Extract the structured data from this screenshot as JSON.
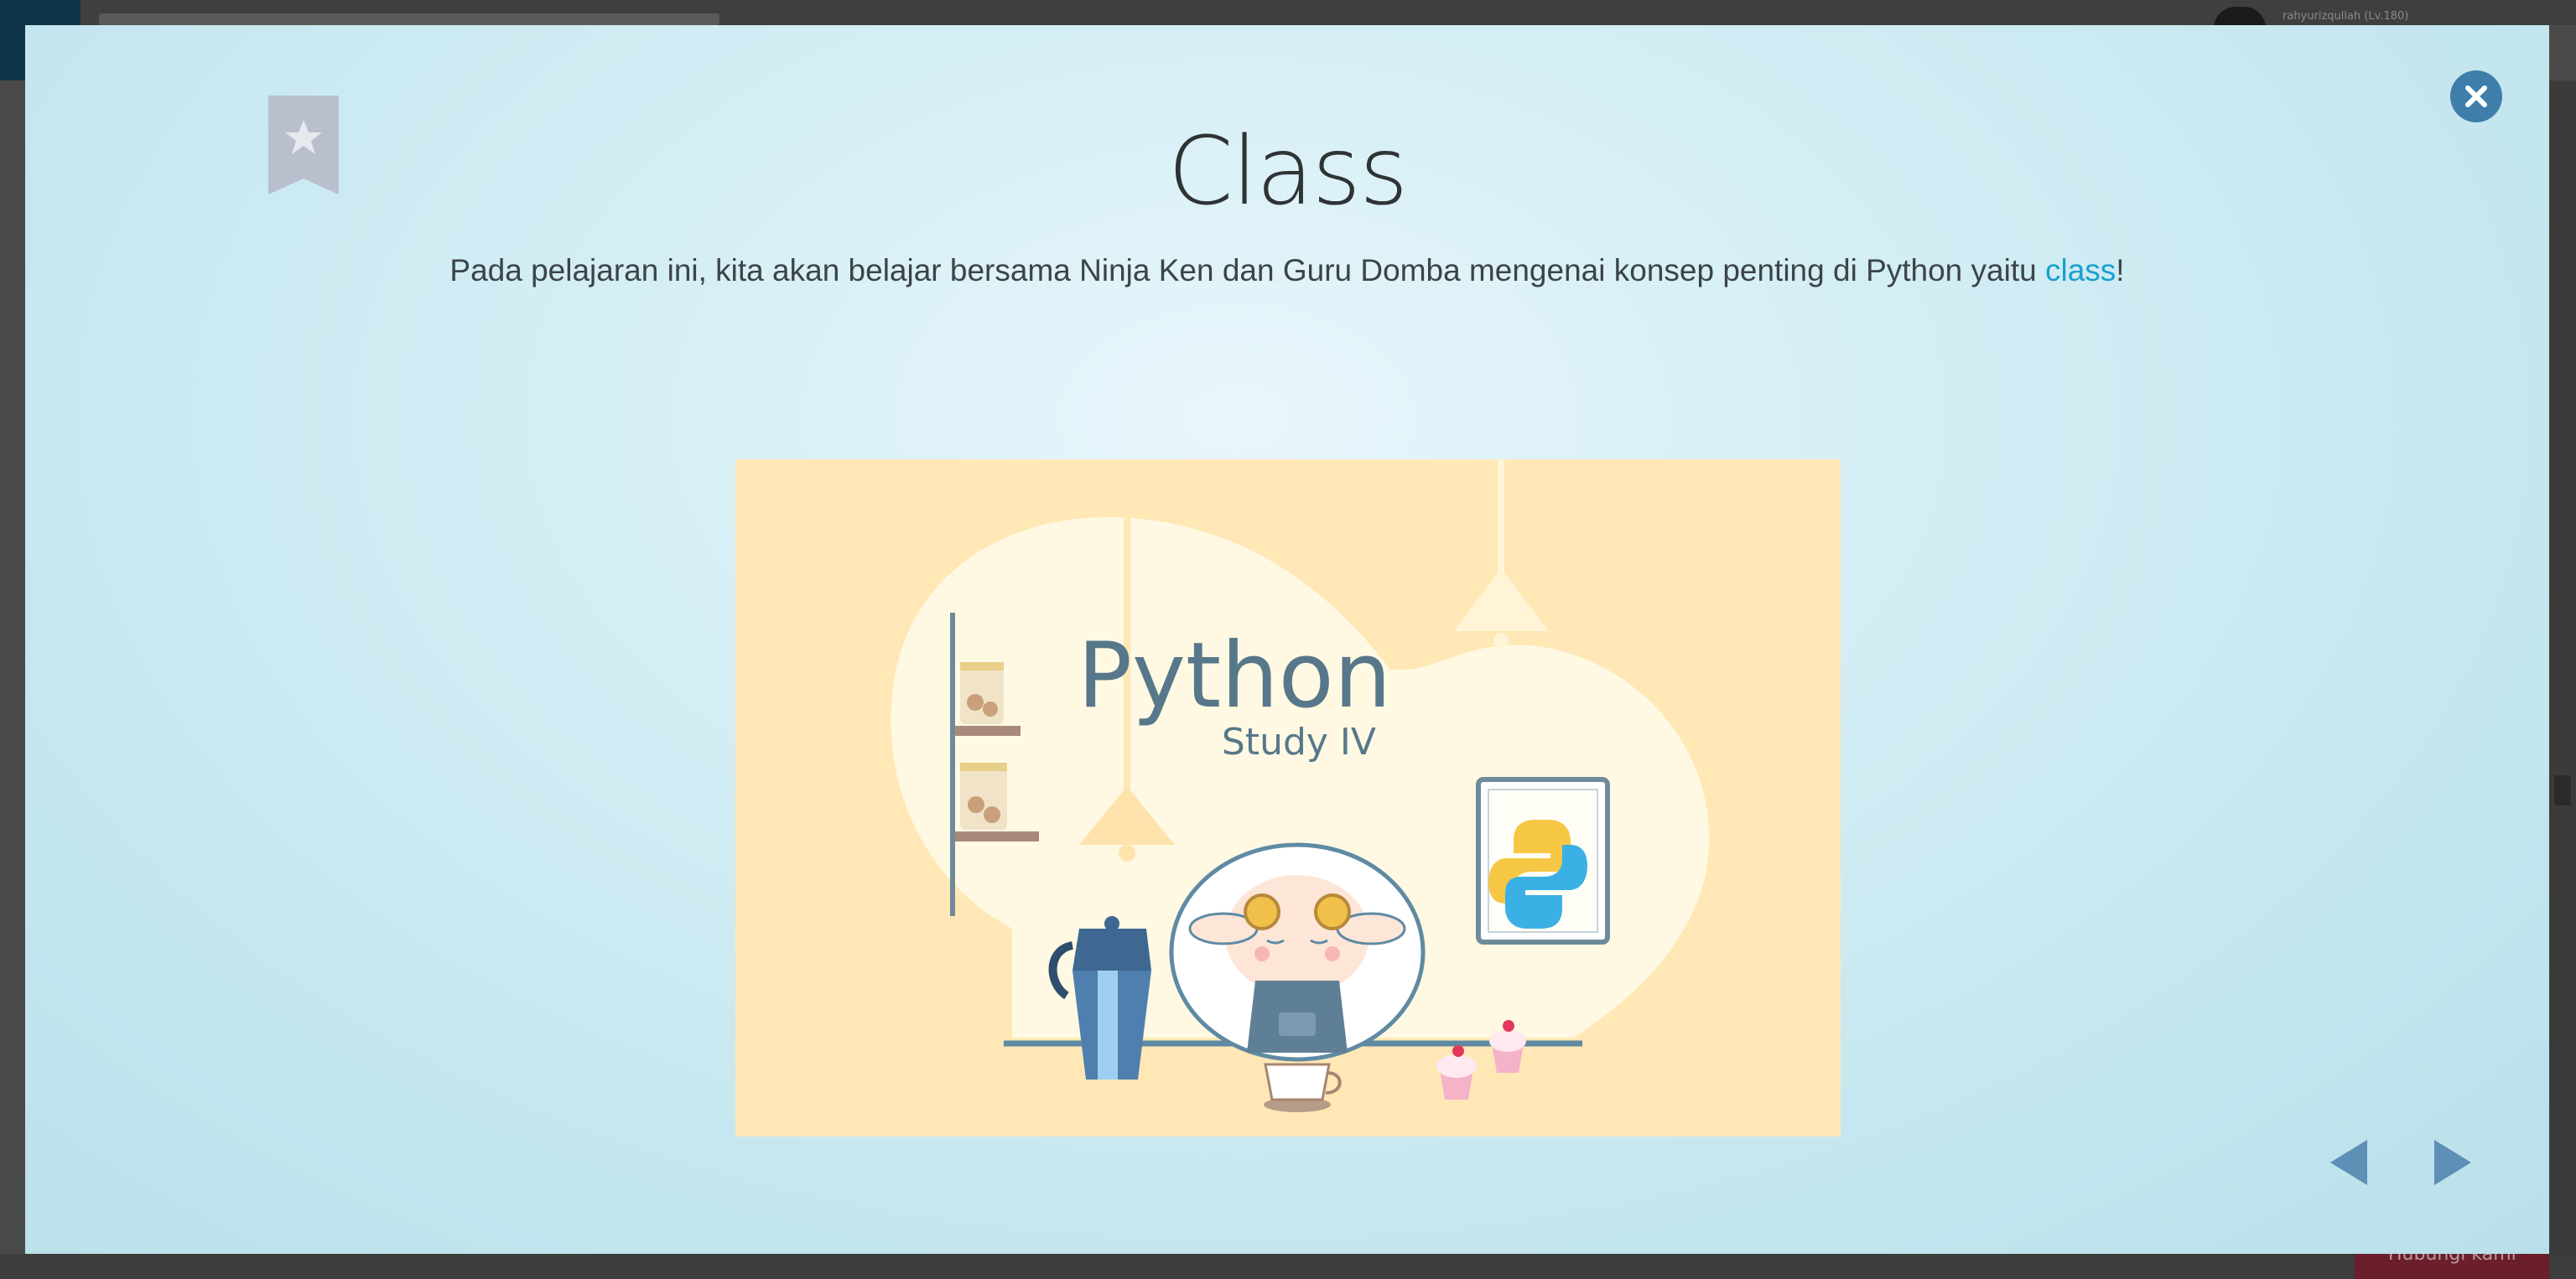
{
  "background": {
    "user_label": "rahyurizqullah (Lv.180)",
    "feedback_label": "Hubungi kami"
  },
  "modal": {
    "title": "Class",
    "description_before_link": "Pada pelajaran ini, kita akan belajar bersama Ninja Ken dan Guru Domba mengenai konsep penting di Python yaitu ",
    "description_link": "class",
    "description_after_link": "!",
    "illustration": {
      "title": "Python",
      "subtitle": "Study IV"
    },
    "icons": {
      "bookmark": "bookmark-star-icon",
      "close": "close-icon",
      "prev": "arrow-left-icon",
      "next": "arrow-right-icon"
    },
    "colors": {
      "accent": "#3f7eab",
      "link": "#1a9fd0",
      "illustration_bg": "#ffe8b6",
      "bookmark": "#b9bfcd"
    }
  }
}
